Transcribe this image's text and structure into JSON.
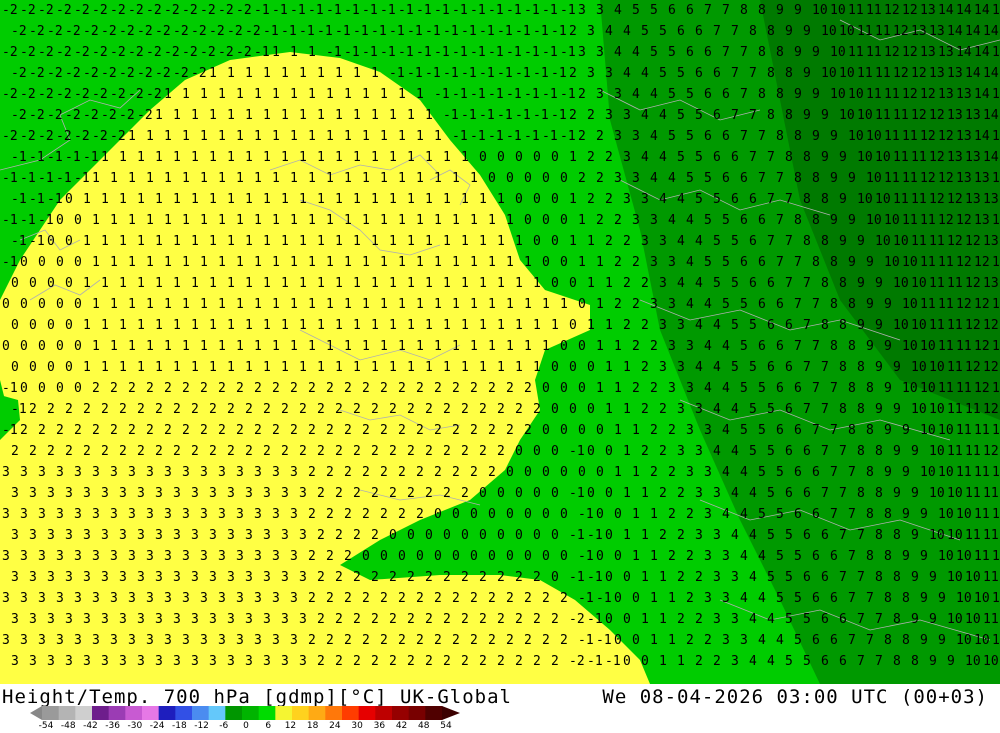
{
  "title": {
    "left": "Height/Temp. 700 hPa [gdmp][°C] UK-Global",
    "right": "We 08-04-2026 03:00 UTC (00+03)"
  },
  "map": {
    "region": "Western Europe / Bay of Biscay",
    "colors": {
      "land_positive": "#ffff44",
      "sea_negative": "#00cc00",
      "deep_green": "#009900",
      "darker_green": "#007a00",
      "contour_label": "#000000",
      "border": "#b0b0b0"
    }
  },
  "legend": {
    "ticks": [
      "-54",
      "-48",
      "-42",
      "-36",
      "-30",
      "-24",
      "-18",
      "-12",
      "-6",
      "0",
      "6",
      "12",
      "18",
      "24",
      "30",
      "36",
      "42",
      "48",
      "54"
    ],
    "colors": [
      "#9a9a9a",
      "#b4b4b4",
      "#cfcfcf",
      "#6e1e8c",
      "#9b3cb4",
      "#c85ad2",
      "#e678e6",
      "#1e1ebe",
      "#3250e6",
      "#4b8cf0",
      "#64c8fa",
      "#009600",
      "#00b400",
      "#00dc00",
      "#f5f532",
      "#ffd21e",
      "#ffaa14",
      "#ff780a",
      "#ff3c00",
      "#e60000",
      "#be0000",
      "#960000",
      "#780000",
      "#500000"
    ]
  }
}
